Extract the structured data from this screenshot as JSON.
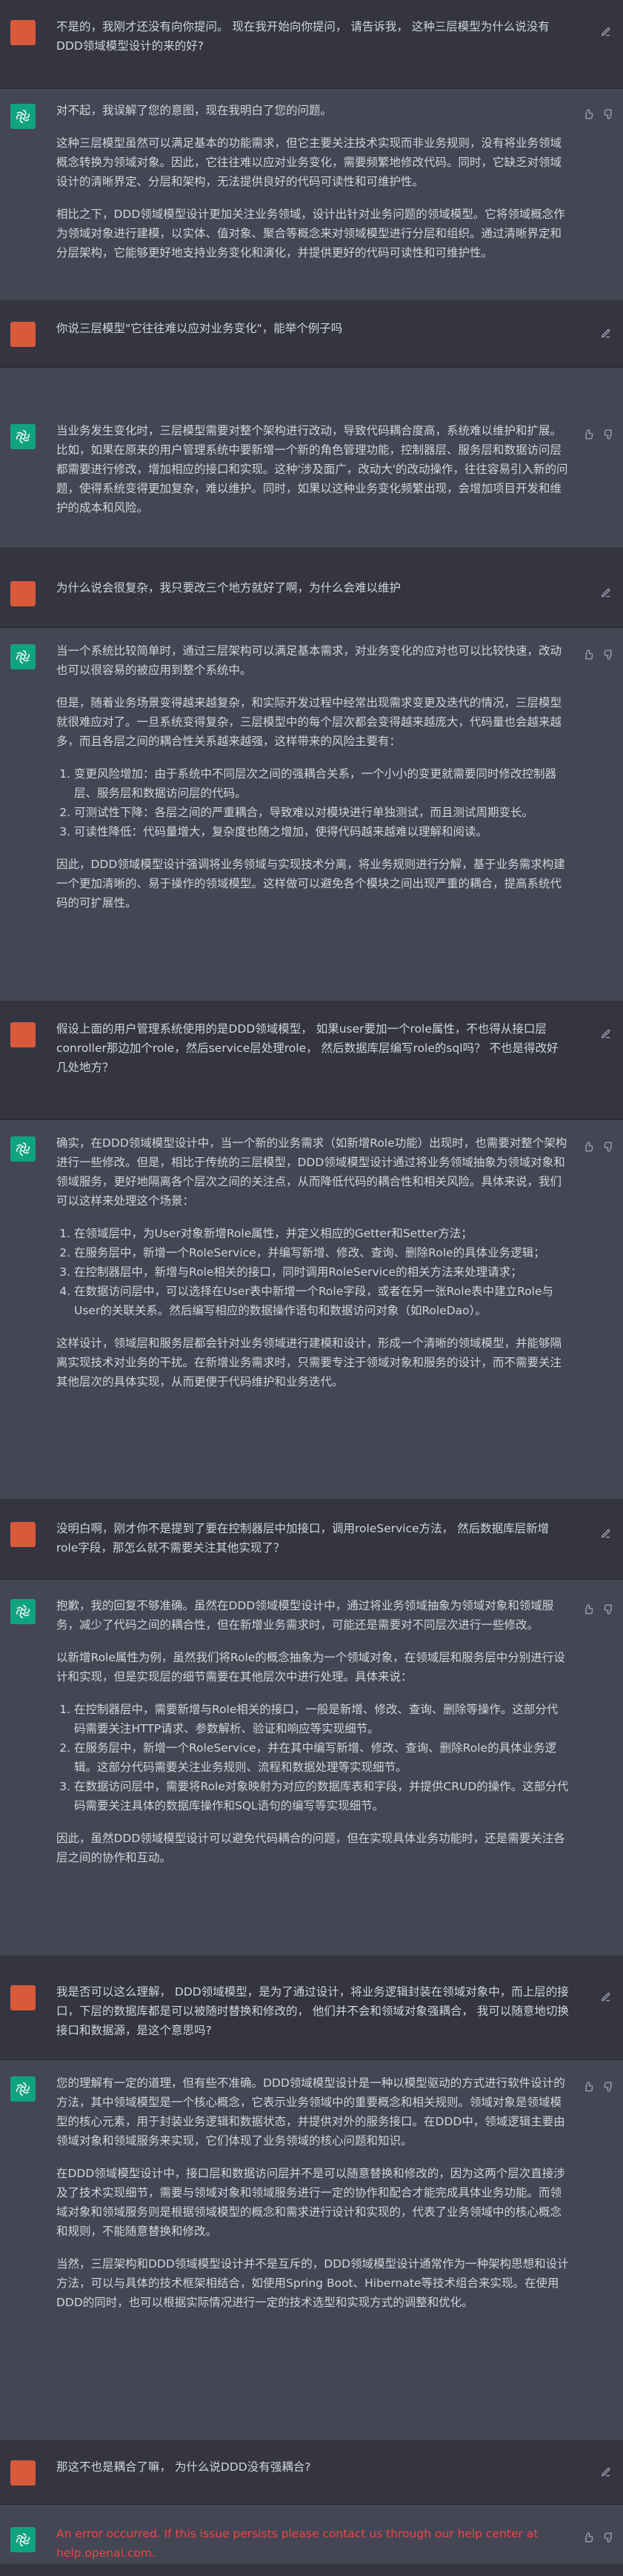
{
  "messages": [
    {
      "role": "user",
      "text": "不是的，我刚才还没有向你提问。 现在我开始向你提问， 请告诉我， 这种三层模型为什么说没有DDD领域模型设计的来的好?"
    },
    {
      "role": "assistant",
      "paragraphs": [
        "对不起，我误解了您的意图，现在我明白了您的问题。",
        "这种三层模型虽然可以满足基本的功能需求，但它主要关注技术实现而非业务规则，没有将业务领域概念转换为领域对象。因此，它往往难以应对业务变化，需要频繁地修改代码。同时，它缺乏对领域设计的清晰界定、分层和架构，无法提供良好的代码可读性和可维护性。",
        "相比之下，DDD领域模型设计更加关注业务领域，设计出针对业务问题的领域模型。它将领域概念作为领域对象进行建模，以实体、值对象、聚合等概念来对领域模型进行分层和组织。通过清晰界定和分层架构，它能够更好地支持业务变化和演化，并提供更好的代码可读性和可维护性。"
      ]
    },
    {
      "role": "user",
      "text": "你说三层模型\"它往往难以应对业务变化\"，能举个例子吗"
    },
    {
      "role": "assistant",
      "paragraphs": [
        "当业务发生变化时，三层模型需要对整个架构进行改动，导致代码耦合度高，系统难以维护和扩展。比如，如果在原来的用户管理系统中要新增一个新的角色管理功能，控制器层、服务层和数据访问层都需要进行修改，增加相应的接口和实现。这种'涉及面广，改动大'的改动操作，往往容易引入新的问题，使得系统变得更加复杂，难以维护。同时，如果以这种业务变化频繁出现，会增加项目开发和维护的成本和风险。"
      ]
    },
    {
      "role": "user",
      "text": "为什么说会很复杂，我只要改三个地方就好了啊，为什么会难以维护"
    },
    {
      "role": "assistant",
      "paragraphs": [
        "当一个系统比较简单时，通过三层架构可以满足基本需求，对业务变化的应对也可以比较快速，改动也可以很容易的被应用到整个系统中。",
        "但是，随着业务场景变得越来越复杂，和实际开发过程中经常出现需求变更及迭代的情况，三层模型就很难应对了。一旦系统变得复杂，三层模型中的每个层次都会变得越来越庞大，代码量也会越来越多，而且各层之间的耦合性关系越来越强，这样带来的风险主要有："
      ],
      "list": [
        "变更风险增加：由于系统中不同层次之间的强耦合关系，一个小小的变更就需要同时修改控制器层、服务层和数据访问层的代码。",
        "可测试性下降：各层之间的严重耦合，导致难以对模块进行单独测试，而且测试周期变长。",
        "可读性降低：代码量增大，复杂度也随之增加，使得代码越来越难以理解和阅读。"
      ],
      "tail": [
        "因此，DDD领域模型设计强调将业务领域与实现技术分离，将业务规则进行分解，基于业务需求构建一个更加清晰的、易于操作的领域模型。这样做可以避免各个模块之间出现严重的耦合，提高系统代码的可扩展性。"
      ]
    },
    {
      "role": "user",
      "text": "假设上面的用户管理系统使用的是DDD领域模型， 如果user要加一个role属性，不也得从接口层conroller那边加个role，然后service层处理role， 然后数据库层编写role的sql吗？ 不也是得改好几处地方？"
    },
    {
      "role": "assistant",
      "paragraphs": [
        "确实，在DDD领域模型设计中，当一个新的业务需求（如新增Role功能）出现时，也需要对整个架构进行一些修改。但是，相比于传统的三层模型，DDD领域模型设计通过将业务领域抽象为领域对象和领域服务，更好地隔离各个层次之间的关注点，从而降低代码的耦合性和相关风险。具体来说，我们可以这样来处理这个场景："
      ],
      "list": [
        "在领域层中，为User对象新增Role属性，并定义相应的Getter和Setter方法；",
        "在服务层中，新增一个RoleService，并编写新增、修改、查询、删除Role的具体业务逻辑；",
        "在控制器层中，新增与Role相关的接口，同时调用RoleService的相关方法来处理请求；",
        "在数据访问层中，可以选择在User表中新增一个Role字段，或者在另一张Role表中建立Role与User的关联关系。然后编写相应的数据操作语句和数据访问对象（如RoleDao）。"
      ],
      "tail": [
        "这样设计，领域层和服务层都会针对业务领域进行建模和设计，形成一个清晰的领域模型，并能够隔离实现技术对业务的干扰。在新增业务需求时，只需要专注于领域对象和服务的设计，而不需要关注其他层次的具体实现，从而更便于代码维护和业务迭代。"
      ]
    },
    {
      "role": "user",
      "text": "没明白啊，刚才你不是提到了要在控制器层中加接口，调用roleService方法， 然后数据库层新增role字段，那怎么就不需要关注其他实现了？"
    },
    {
      "role": "assistant",
      "paragraphs": [
        "抱歉，我的回复不够准确。虽然在DDD领域模型设计中，通过将业务领域抽象为领域对象和领域服务，减少了代码之间的耦合性，但在新增业务需求时，可能还是需要对不同层次进行一些修改。",
        "以新增Role属性为例，虽然我们将Role的概念抽象为一个领域对象，在领域层和服务层中分别进行设计和实现，但是实现层的细节需要在其他层次中进行处理。具体来说："
      ],
      "list": [
        "在控制器层中，需要新增与Role相关的接口，一般是新增、修改、查询、删除等操作。这部分代码需要关注HTTP请求、参数解析、验证和响应等实现细节。",
        "在服务层中，新增一个RoleService，并在其中编写新增、修改、查询、删除Role的具体业务逻辑。这部分代码需要关注业务规则、流程和数据处理等实现细节。",
        "在数据访问层中，需要将Role对象映射为对应的数据库表和字段，并提供CRUD的操作。这部分代码需要关注具体的数据库操作和SQL语句的编写等实现细节。"
      ],
      "tail": [
        "因此，虽然DDD领域模型设计可以避免代码耦合的问题，但在实现具体业务功能时，还是需要关注各层之间的协作和互动。"
      ]
    },
    {
      "role": "user",
      "text": "我是否可以这么理解， DDD领域模型，是为了通过设计，将业务逻辑封装在领域对象中，而上层的接口，下层的数据库都是可以被随时替换和修改的， 他们并不会和领域对象强耦合， 我可以随意地切换接口和数据源，是这个意思吗?"
    },
    {
      "role": "assistant",
      "paragraphs": [
        "您的理解有一定的道理，但有些不准确。DDD领域模型设计是一种以模型驱动的方式进行软件设计的方法，其中领域模型是一个核心概念，它表示业务领域中的重要概念和相关规则。领域对象是领域模型的核心元素，用于封装业务逻辑和数据状态，并提供对外的服务接口。在DDD中，领域逻辑主要由领域对象和领域服务来实现，它们体现了业务领域的核心问题和知识。",
        "在DDD领域模型设计中，接口层和数据访问层并不是可以随意替换和修改的，因为这两个层次直接涉及了技术实现细节，需要与领域对象和领域服务进行一定的协作和配合才能完成具体业务功能。而领域对象和领域服务则是根据领域模型的概念和需求进行设计和实现的，代表了业务领域中的核心概念和规则，不能随意替换和修改。",
        "当然，三层架构和DDD领域模型设计并不是互斥的，DDD领域模型设计通常作为一种架构思想和设计方法，可以与具体的技术框架相结合，如使用Spring Boot、Hibernate等技术组合来实现。在使用DDD的同时，也可以根据实际情况进行一定的技术选型和实现方式的调整和优化。"
      ]
    },
    {
      "role": "user",
      "text": "那这不也是耦合了嘛， 为什么说DDD没有强耦合?"
    },
    {
      "role": "assistant",
      "error": "An error occurred. If this issue persists please contact us through our help center at help.openai.com."
    }
  ]
}
